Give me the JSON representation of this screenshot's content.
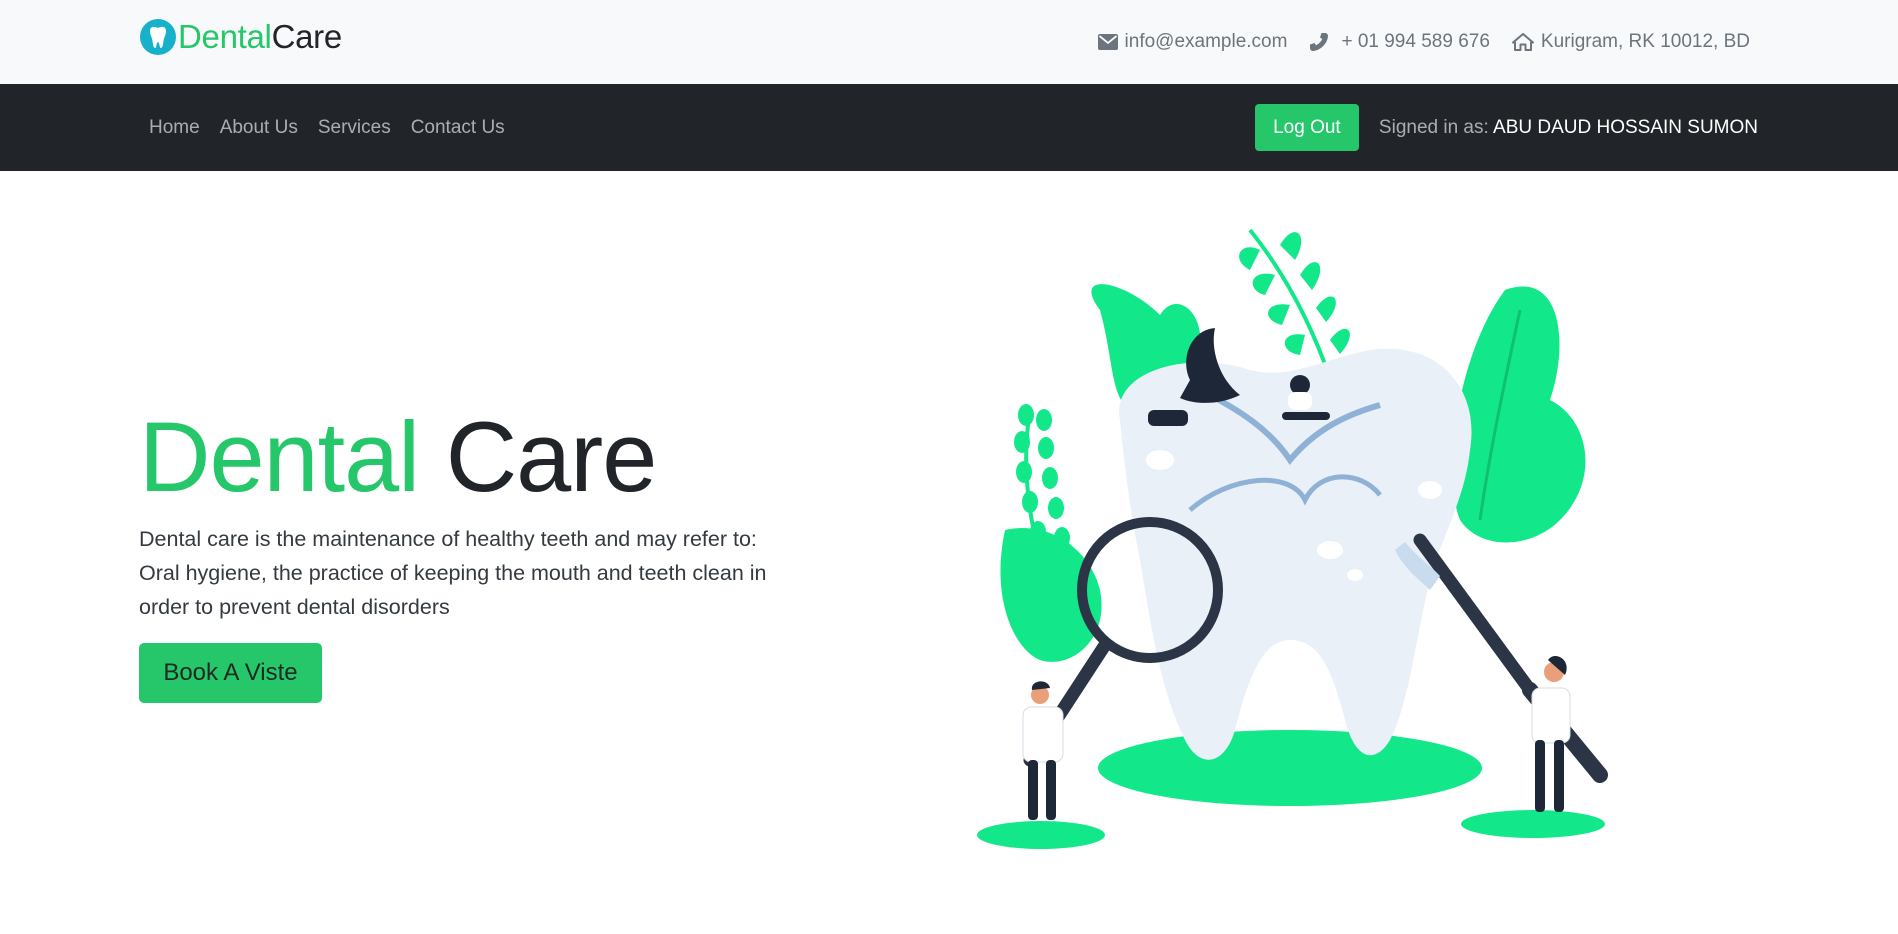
{
  "brand": {
    "part1": "Dental",
    "part2": "Care"
  },
  "contacts": {
    "email": "info@example.com",
    "phone": "+ 01 994 589 676",
    "address": "Kurigram, RK 10012, BD"
  },
  "nav": {
    "links": [
      "Home",
      "About Us",
      "Services",
      "Contact Us"
    ],
    "logout_label": "Log Out",
    "signed_in_label": "Signed in as:",
    "user_name": "ABU DAUD HOSSAIN SUMON"
  },
  "hero": {
    "title_part1": "Dental",
    "title_part2": "Care",
    "description": "Dental care is the maintenance of healthy teeth and may refer to: Oral hygiene, the practice of keeping the mouth and teeth clean in order to prevent dental disorders",
    "cta_label": "Book A Viste"
  },
  "icons": {
    "logo": "tooth-icon",
    "email": "envelope-icon",
    "phone": "phone-icon",
    "address": "home-icon"
  },
  "colors": {
    "accent": "#25c76a",
    "illustration_green": "#12e88a",
    "dark": "#212529",
    "logo_circle": "#17b2c9"
  }
}
